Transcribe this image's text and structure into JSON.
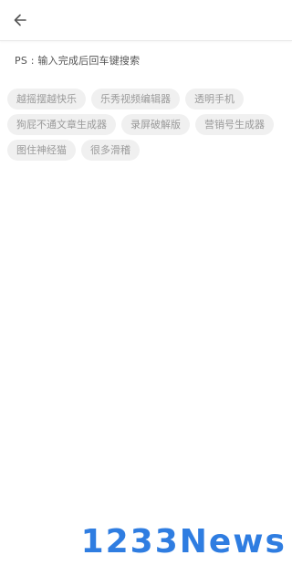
{
  "header": {
    "back_icon": "arrow-left-icon"
  },
  "hint_text": "PS : 输入完成后回车键搜索",
  "tags": [
    "越摇摆越快乐",
    "乐秀视频编辑器",
    "透明手机",
    "狗屁不通文章生成器",
    "录屏破解版",
    "营销号生成器",
    "图住神经猫",
    "很多滑稽"
  ],
  "watermark": "1233News",
  "colors": {
    "tag_background": "#f0f0f0",
    "tag_text": "#9a9a9a",
    "watermark": "#2f7de1"
  }
}
